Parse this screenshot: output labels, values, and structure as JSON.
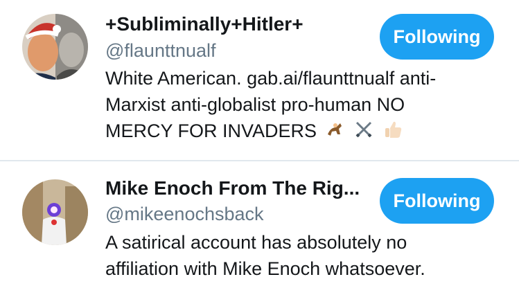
{
  "users": [
    {
      "display_name": "+Subliminally+Hitler+",
      "handle": "@flaunttnualf",
      "bio_lines": [
        "White American. gab.ai/flaunttnualf anti-",
        "Marxist anti-globalist pro-human NO",
        "MERCY FOR INVADERS"
      ],
      "bio_emoji_icons": [
        "horse-racing-icon",
        "crossed-swords-icon",
        "thumbs-up-icon"
      ],
      "follow_label": "Following"
    },
    {
      "display_name": "Mike Enoch From The Rig...",
      "handle": "@mikeenochsback",
      "bio_lines": [
        "A satirical account has absolutely no",
        "affiliation with Mike Enoch whatsoever."
      ],
      "follow_label": "Following"
    }
  ],
  "colors": {
    "accent": "#1da1f2",
    "handle_text": "#657786",
    "divider": "#e1e8ed"
  }
}
